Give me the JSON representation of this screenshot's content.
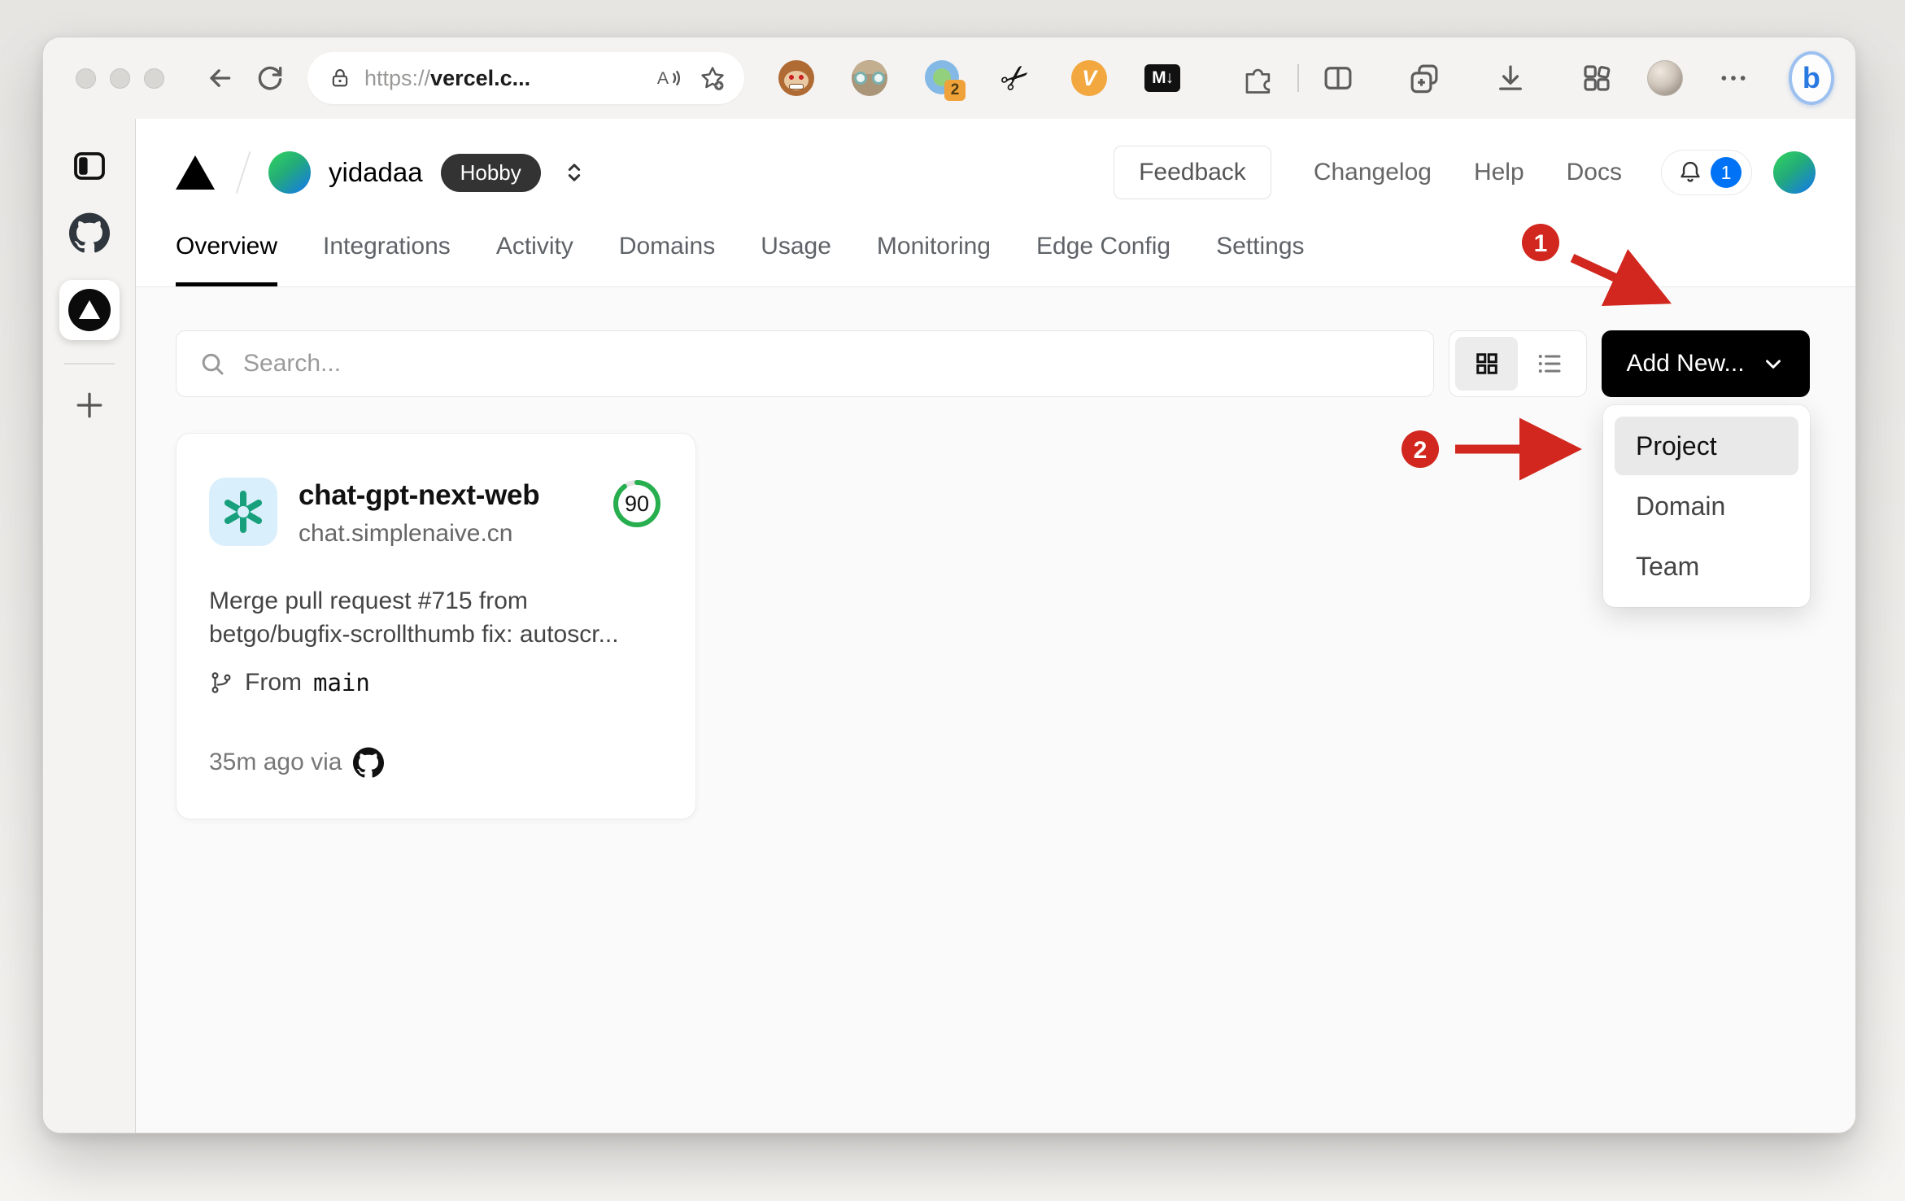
{
  "browser": {
    "url": {
      "scheme": "https://",
      "host": "vercel.c..."
    },
    "extensions": {
      "tab_counter_badge": "2",
      "scissors_glyph": "✂",
      "v_label": "V",
      "markdown_label": "M↓"
    },
    "bing_label": "b"
  },
  "app": {
    "team": {
      "name": "yidadaa",
      "plan": "Hobby"
    },
    "header": {
      "feedback": "Feedback",
      "links": [
        "Changelog",
        "Help",
        "Docs"
      ],
      "notification_count": "1"
    },
    "tabs": [
      {
        "label": "Overview",
        "active": true
      },
      {
        "label": "Integrations"
      },
      {
        "label": "Activity"
      },
      {
        "label": "Domains"
      },
      {
        "label": "Usage"
      },
      {
        "label": "Monitoring"
      },
      {
        "label": "Edge Config"
      },
      {
        "label": "Settings"
      }
    ],
    "toolbar": {
      "search_placeholder": "Search...",
      "add_new": "Add New..."
    },
    "dropdown": {
      "items": [
        {
          "label": "Project",
          "highlighted": true
        },
        {
          "label": "Domain"
        },
        {
          "label": "Team"
        }
      ]
    },
    "project": {
      "name": "chat-gpt-next-web",
      "domain": "chat.simplenaive.cn",
      "score": "90",
      "commit_line1": "Merge pull request #715 from",
      "commit_line2": "betgo/bugfix-scrollthumb fix: autoscr...",
      "from_label": "From",
      "branch": "main",
      "deployed": "35m ago via"
    }
  },
  "annotations": {
    "step1": "1",
    "step2": "2"
  },
  "colors": {
    "accent_green": "#27ae4e",
    "badge_blue": "#0072f5",
    "annotation_red": "#d1271e",
    "openai_teal": "#18a07c"
  }
}
